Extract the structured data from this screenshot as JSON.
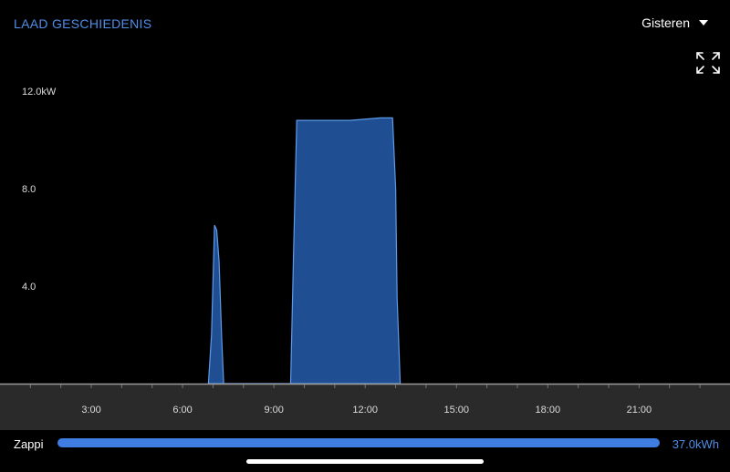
{
  "header": {
    "title": "LAAD GESCHIEDENIS",
    "period": "Gisteren",
    "expand_icon": "expand-arrows-icon"
  },
  "chart_data": {
    "type": "area",
    "xlabel": "",
    "ylabel": "",
    "x_ticks": [
      "3:00",
      "6:00",
      "9:00",
      "12:00",
      "15:00",
      "18:00",
      "21:00"
    ],
    "y_ticks": [
      "4.0",
      "8.0",
      "12.0kW"
    ],
    "ylim": [
      0,
      12.0
    ],
    "xlim_hours": [
      0,
      24
    ],
    "grid": false,
    "series": [
      {
        "color": "#1f4f92",
        "x_hours": [
          6.85,
          6.95,
          7.05,
          7.12,
          7.2,
          7.28,
          7.35,
          7.38,
          9.55,
          9.65,
          9.75,
          9.85,
          10.5,
          11.5,
          12.5,
          12.9,
          13.0,
          13.05,
          13.15
        ],
        "values": [
          0,
          2.0,
          6.5,
          6.3,
          5.0,
          2.0,
          0,
          0,
          0,
          5.5,
          10.8,
          10.8,
          10.8,
          10.8,
          10.9,
          10.9,
          8.0,
          3.5,
          0
        ]
      }
    ]
  },
  "footer": {
    "label": "Zappi",
    "progress": 1.0,
    "energy": "37.0kWh"
  },
  "colors": {
    "accent": "#4f8ee8",
    "fill": "#1f4f92",
    "stroke": "#5d9ae8",
    "axis_band": "#2a2a2a"
  }
}
